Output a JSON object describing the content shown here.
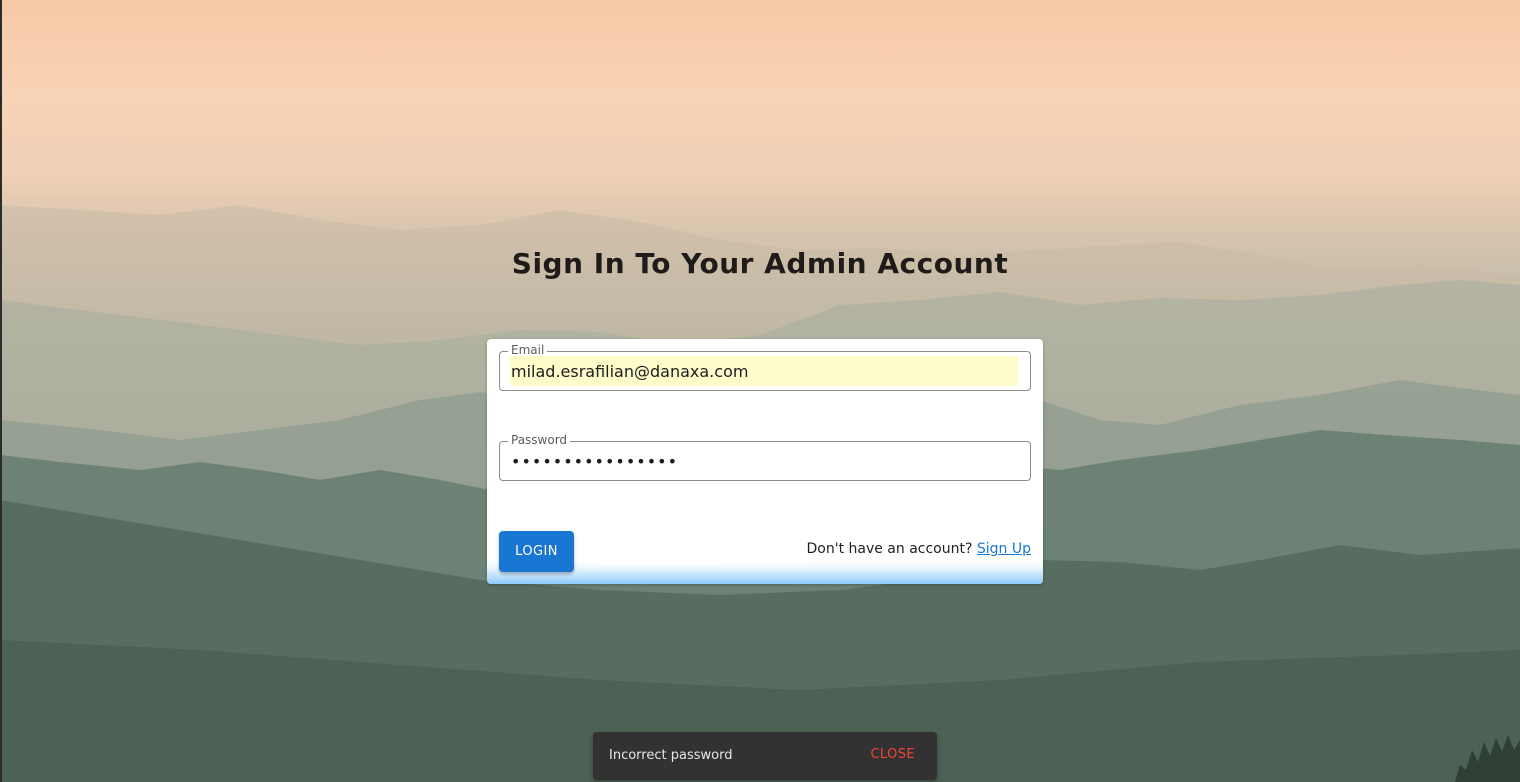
{
  "page": {
    "heading": "Sign In To Your Admin Account"
  },
  "form": {
    "email": {
      "label": "Email",
      "value": "milad.esrafilian@danaxa.com"
    },
    "password": {
      "label": "Password",
      "value": "••••••••••••••••"
    },
    "login_label": "LOGIN",
    "signup_prompt": "Don't have an account?",
    "signup_link": "Sign Up"
  },
  "snackbar": {
    "message": "Incorrect password",
    "close_label": "CLOSE"
  },
  "colors": {
    "primary": "#1976d2",
    "snackbar_bg": "#323232",
    "snackbar_action": "#f44336",
    "autofill_bg": "#fffccc"
  }
}
